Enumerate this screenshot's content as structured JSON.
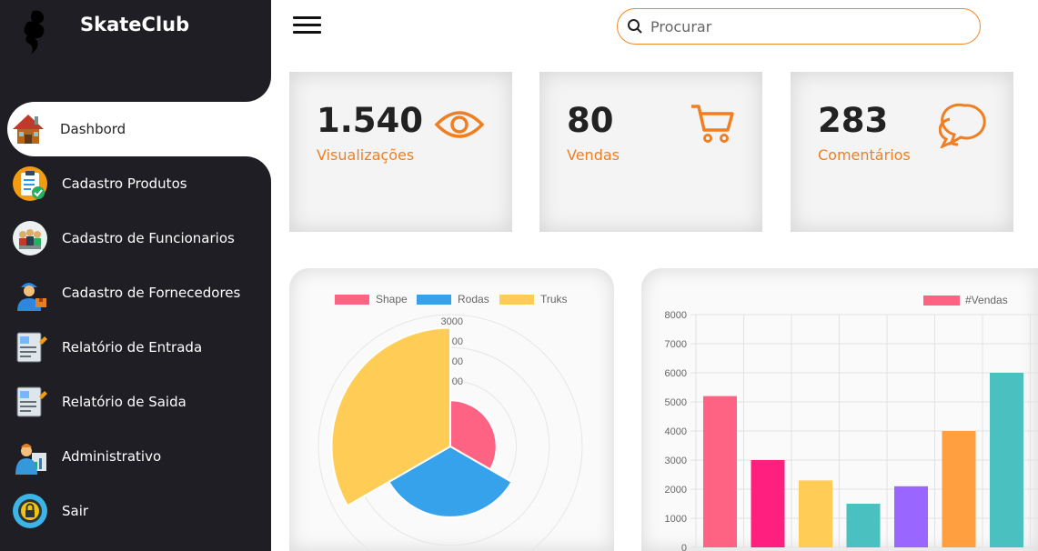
{
  "brand": {
    "name": "SkateClub"
  },
  "sidebar": {
    "items": [
      {
        "label": "Dashbord",
        "icon": "house-icon",
        "active": true
      },
      {
        "label": "Cadastro Produtos",
        "icon": "clipboard-check-icon"
      },
      {
        "label": "Cadastro de Funcionarios",
        "icon": "team-icon"
      },
      {
        "label": "Cadastro de Fornecedores",
        "icon": "delivery-man-icon"
      },
      {
        "label": "Relatório de Entrada",
        "icon": "report-in-icon"
      },
      {
        "label": "Relatório de Saida",
        "icon": "report-out-icon"
      },
      {
        "label": "Administrativo",
        "icon": "admin-icon"
      },
      {
        "label": "Sair",
        "icon": "lock-icon"
      }
    ]
  },
  "topbar": {
    "search_placeholder": "Procurar"
  },
  "cards": [
    {
      "value": "1.540",
      "label": "Visualizações",
      "icon": "eye-icon"
    },
    {
      "value": "80",
      "label": "Vendas",
      "icon": "cart-icon"
    },
    {
      "value": "283",
      "label": "Comentários",
      "icon": "chat-icon"
    }
  ],
  "colors": {
    "accent": "#ef7f22",
    "sidebar": "#1e1e24"
  },
  "chart_data": [
    {
      "type": "polarArea",
      "categories": [
        "Shape",
        "Rodas",
        "Truks"
      ],
      "values": [
        1400,
        2150,
        3600
      ],
      "colors": [
        "#ff6384",
        "#36a2eb",
        "#ffcd56"
      ],
      "r_ticks": [
        "3000",
        "00",
        "00",
        "00"
      ],
      "legend": "top"
    },
    {
      "type": "bar",
      "series": [
        {
          "name": "#Vendas",
          "values": [
            5200,
            3000,
            2300,
            1500,
            2100,
            4000,
            6000
          ]
        }
      ],
      "colors": [
        "#ff6384",
        "#ff1f7e",
        "#ffcd56",
        "#4bc0c0",
        "#9966ff",
        "#ff9f40",
        "#4bc0c0"
      ],
      "ylim": [
        0,
        8000
      ],
      "y_ticks": [
        "8000",
        "7000",
        "6000",
        "5000",
        "4000",
        "3000",
        "2000",
        "1000",
        "0"
      ],
      "legend": "top"
    }
  ]
}
